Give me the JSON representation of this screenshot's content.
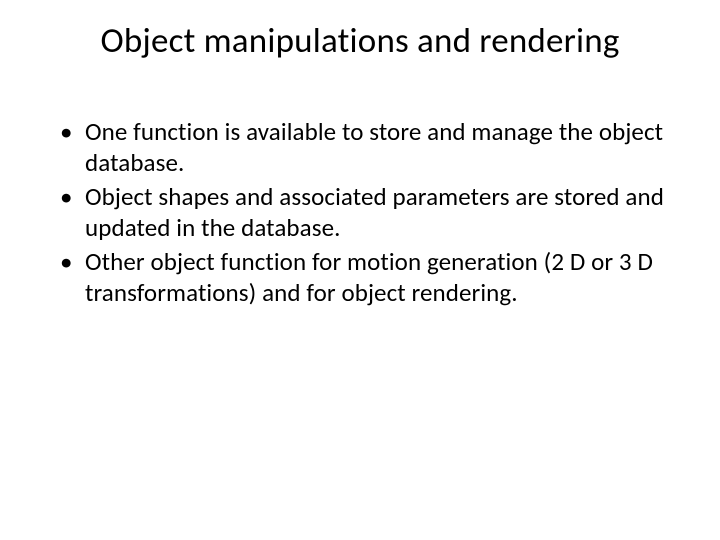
{
  "slide": {
    "title": "Object manipulations and rendering",
    "bullets": [
      "One function is available to store and manage the object database.",
      "Object shapes and associated parameters are stored and updated in the database.",
      "Other object function for  motion generation (2 D or 3 D transformations) and for object rendering."
    ]
  }
}
